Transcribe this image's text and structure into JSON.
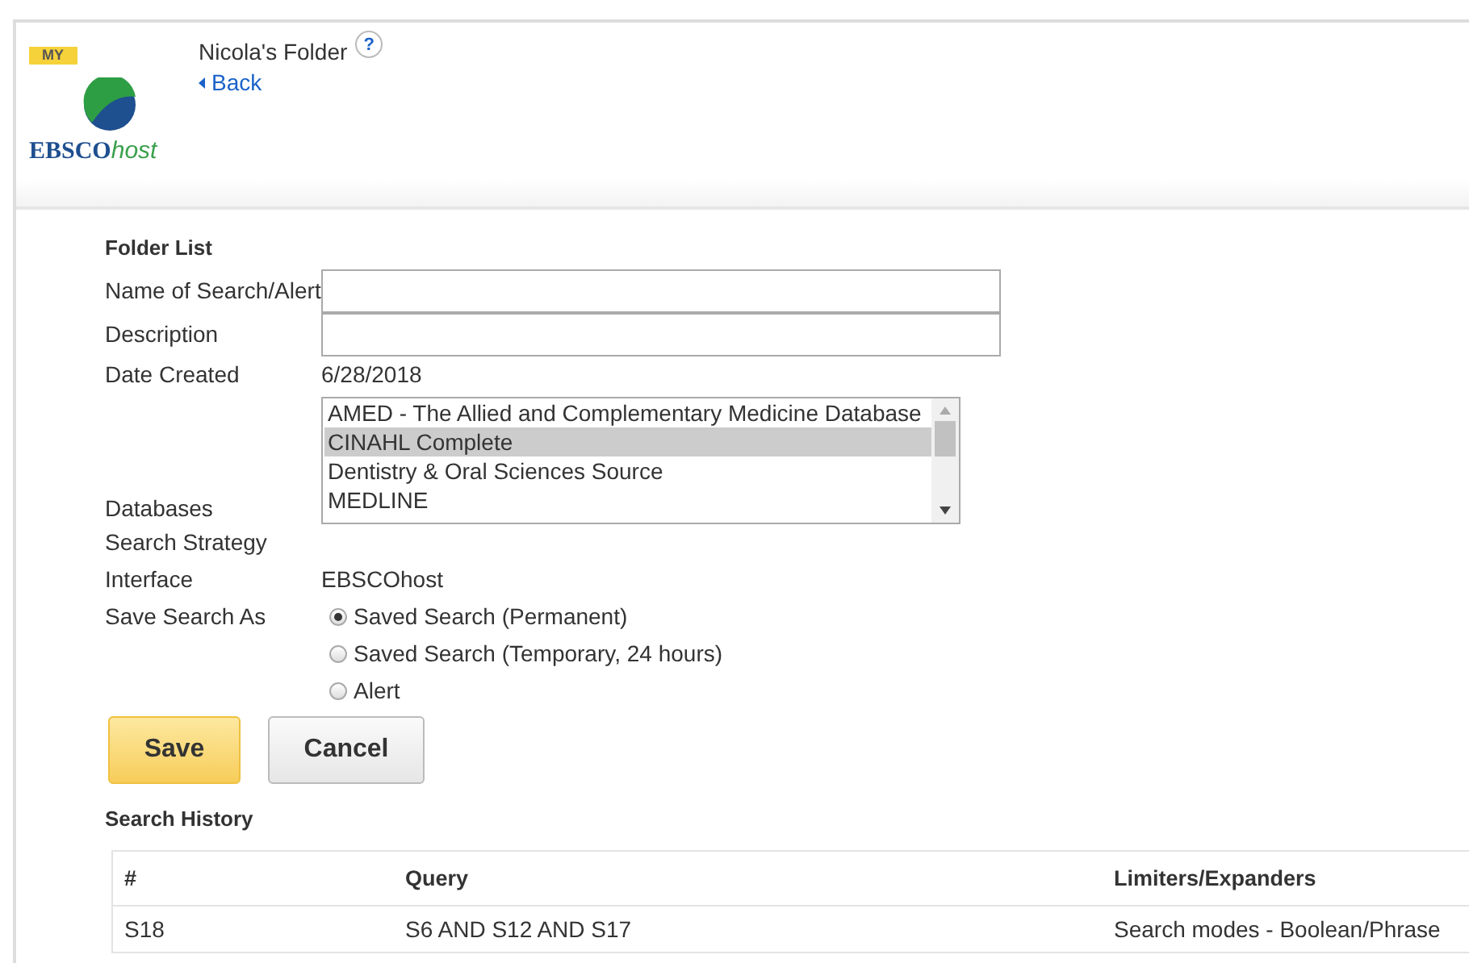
{
  "header": {
    "badge": "MY",
    "logo_text": "EBSCO",
    "logo_suffix": "host",
    "folder_title": "Nicola's Folder",
    "help": "?",
    "back": "Back"
  },
  "form": {
    "title": "Folder List",
    "name_label": "Name of Search/Alert",
    "description_label": "Description",
    "date_label": "Date Created",
    "date_value": "6/28/2018",
    "databases_label": "Databases",
    "databases": [
      {
        "name": "AMED - The Allied and Complementary Medicine Database",
        "selected": false
      },
      {
        "name": "CINAHL Complete",
        "selected": true
      },
      {
        "name": "Dentistry & Oral Sciences Source",
        "selected": false
      },
      {
        "name": "MEDLINE",
        "selected": false
      }
    ],
    "strategy_label": "Search Strategy",
    "interface_label": "Interface",
    "interface_value": "EBSCOhost",
    "save_as_label": "Save Search As",
    "save_options": [
      {
        "label": "Saved Search (Permanent)",
        "selected": true
      },
      {
        "label": "Saved Search (Temporary, 24 hours)",
        "selected": false
      },
      {
        "label": "Alert",
        "selected": false
      }
    ],
    "buttons": [
      {
        "label": "Save",
        "kind": "primary"
      },
      {
        "label": "Cancel",
        "kind": "secondary"
      }
    ]
  },
  "history": {
    "title": "Search History",
    "columns": [
      "#",
      "Query",
      "Limiters/Expanders"
    ],
    "rows": [
      [
        "S18",
        "S6 AND S12 AND S17",
        "Search modes - Boolean/Phrase"
      ]
    ]
  }
}
